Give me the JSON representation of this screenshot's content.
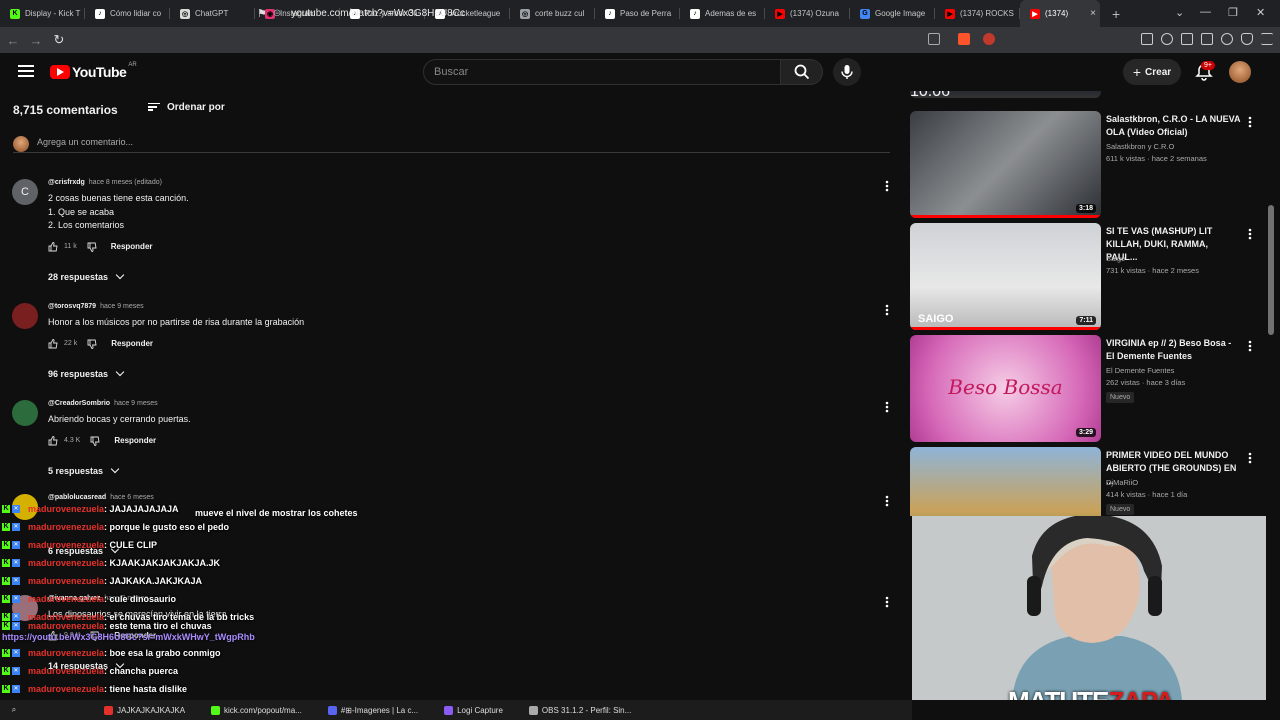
{
  "browser": {
    "tabs": [
      {
        "label": "Display - Kick T",
        "color": "#53fc18",
        "glyph": "K"
      },
      {
        "label": "Cómo lidiar co",
        "color": "#ffffff",
        "glyph": "♪"
      },
      {
        "label": "ChatGPT",
        "color": "#d9d9d9",
        "glyph": "◎"
      },
      {
        "label": "Instagram",
        "color": "#e1306c",
        "glyph": "◉"
      },
      {
        "label": "Paz y amor Oli",
        "color": "#ffffff",
        "glyph": "♪"
      },
      {
        "label": "#rocketleague",
        "color": "#ffffff",
        "glyph": "♪"
      },
      {
        "label": "corte buzz cul",
        "color": "#9aa0a6",
        "glyph": "◎"
      },
      {
        "label": "Paso de Perra",
        "color": "#ffffff",
        "glyph": "♪"
      },
      {
        "label": "Ademas de es",
        "color": "#ffffff",
        "glyph": "♪"
      },
      {
        "label": "(1374) Ozuna",
        "color": "#ff0000",
        "glyph": "▶"
      },
      {
        "label": "Google Image",
        "color": "#4285f4",
        "glyph": "G"
      },
      {
        "label": "(1374) ROCKS",
        "color": "#ff0000",
        "glyph": "▶"
      }
    ],
    "active_tab": {
      "label": "(1374)",
      "close": "×"
    },
    "new_tab": "+",
    "url": "youtube.com/watch?v=Wx3G8H6U8Cc"
  },
  "youtube": {
    "logo_text": "YouTube",
    "country": "AR",
    "search_placeholder": "Buscar",
    "create_label": "Crear",
    "notif_badge": "9+"
  },
  "comments": {
    "count_label": "8,715 comentarios",
    "sort_label": "Ordenar por",
    "add_placeholder": "Agrega un comentario...",
    "items": [
      {
        "user": "@crisfrxdg",
        "meta": "hace 8 meses (editado)",
        "text": "2 cosas buenas tiene esta canción.\n1. Que se acaba\n2. Los comentarios",
        "likes": "11 k",
        "reply": "Responder",
        "replies": "28 respuestas",
        "avatar_letter": "C"
      },
      {
        "user": "@torosvq7879",
        "meta": "hace 9 meses",
        "text": "Honor a los músicos por no partirse de risa durante la grabación",
        "likes": "22 k",
        "reply": "Responder",
        "replies": "96 respuestas"
      },
      {
        "user": "@CreadorSombrio",
        "meta": "hace 9 meses",
        "text": "Abriendo bocas y cerrando puertas.",
        "likes": "4.3 K",
        "reply": "Responder",
        "replies": "5 respuestas"
      },
      {
        "user": "@pablolucasread",
        "meta": "hace 6 meses",
        "text": "",
        "likes": "",
        "reply": "",
        "replies": "6 respuestas"
      },
      {
        "user": "@ivanna.galvez",
        "meta": "hace 9 meses",
        "text": "Los dinosaurios se merecían vivir en la tierra",
        "likes": "9.9 K",
        "reply": "Responder",
        "replies": "14 respuestas"
      }
    ]
  },
  "chat": {
    "lines": [
      {
        "user": "madurovenezuela",
        "msg": ": JAJAJAJAJAJA"
      },
      {
        "user": "madurovenezuela",
        "msg": ": porque le gusto eso el pedo"
      },
      {
        "user": "madurovenezuela",
        "msg": ": CULE CLIP"
      },
      {
        "user": "madurovenezuela",
        "msg": ": KJAAKJAKJAKJAKJA.JK"
      },
      {
        "user": "madurovenezuela",
        "msg": ": JAJKAKA.JAKJKAJA"
      },
      {
        "user": "madurovenezuela",
        "msg": ": cule dinosaurio"
      },
      {
        "user": "madurovenezuela",
        "msg": ": el chuvas tiro tema de la bb tricks"
      },
      {
        "user": "madurovenezuela",
        "msg": ": este tema tiro el chuvas"
      },
      {
        "user": "madurovenezuela",
        "msg": ": boe esa la grabo conmigo"
      },
      {
        "user": "madurovenezuela",
        "msg": ": chancha puerca"
      },
      {
        "user": "madurovenezuela",
        "msg": ": tiene hasta dislike"
      }
    ],
    "link": "https://youtu.be/Wx3G8H6U8Cc?si=mWxkWHwY_tWgpRhb",
    "overlay_text": "mueve el nivel de mostrar los cohetes"
  },
  "sidebar": {
    "top_duration": "10:06",
    "videos": [
      {
        "title": "Salastkbron, C.R.O - LA NUEVA OLA (Video Oficial)",
        "channel": "Salastkbron y C.R.O",
        "views": "611 k vistas · hace 2 semanas",
        "duration": "3:18",
        "badge": "",
        "progress": 1.0
      },
      {
        "title": "SI TE VAS (MASHUP) LIT KILLAH, DUKI, RAMMA, PAUL...",
        "channel": "Saigo",
        "views": "731 k vistas · hace 2 meses",
        "duration": "7:11",
        "badge": "",
        "progress": 1.0,
        "thumb_text": "SAIGO"
      },
      {
        "title": "VIRGINIA ep // 2) Beso Bosa - El Demente Fuentes",
        "channel": "El Demente Fuentes",
        "views": "262 vistas · hace 3 días",
        "duration": "3:29",
        "badge": "Nuevo",
        "progress": 0,
        "thumb_text": "Beso Bossa"
      },
      {
        "title": "PRIMER VIDEO DEL MUNDO ABIERTO (THE GROUNDS) EN ...",
        "channel": "DjMaRiiO",
        "views": "414 k vistas · hace 1 día",
        "duration": "",
        "badge": "Nuevo",
        "progress": 0
      }
    ]
  },
  "webcam": {
    "name_white": "MATUTE",
    "name_red": "ZAPA"
  },
  "taskbar": {
    "items": [
      {
        "label": "JAJKAJKAJKAJKA",
        "color": "#e5312b"
      },
      {
        "label": "kick.com/popout/ma...",
        "color": "#53fc18"
      },
      {
        "label": "#⊞-Imagenes | La c...",
        "color": "#5865f2"
      },
      {
        "label": "Logi Capture",
        "color": "#8a5cf5"
      },
      {
        "label": "OBS 31.1.2 - Perfil: Sin...",
        "color": "#aaaaaa"
      }
    ]
  }
}
